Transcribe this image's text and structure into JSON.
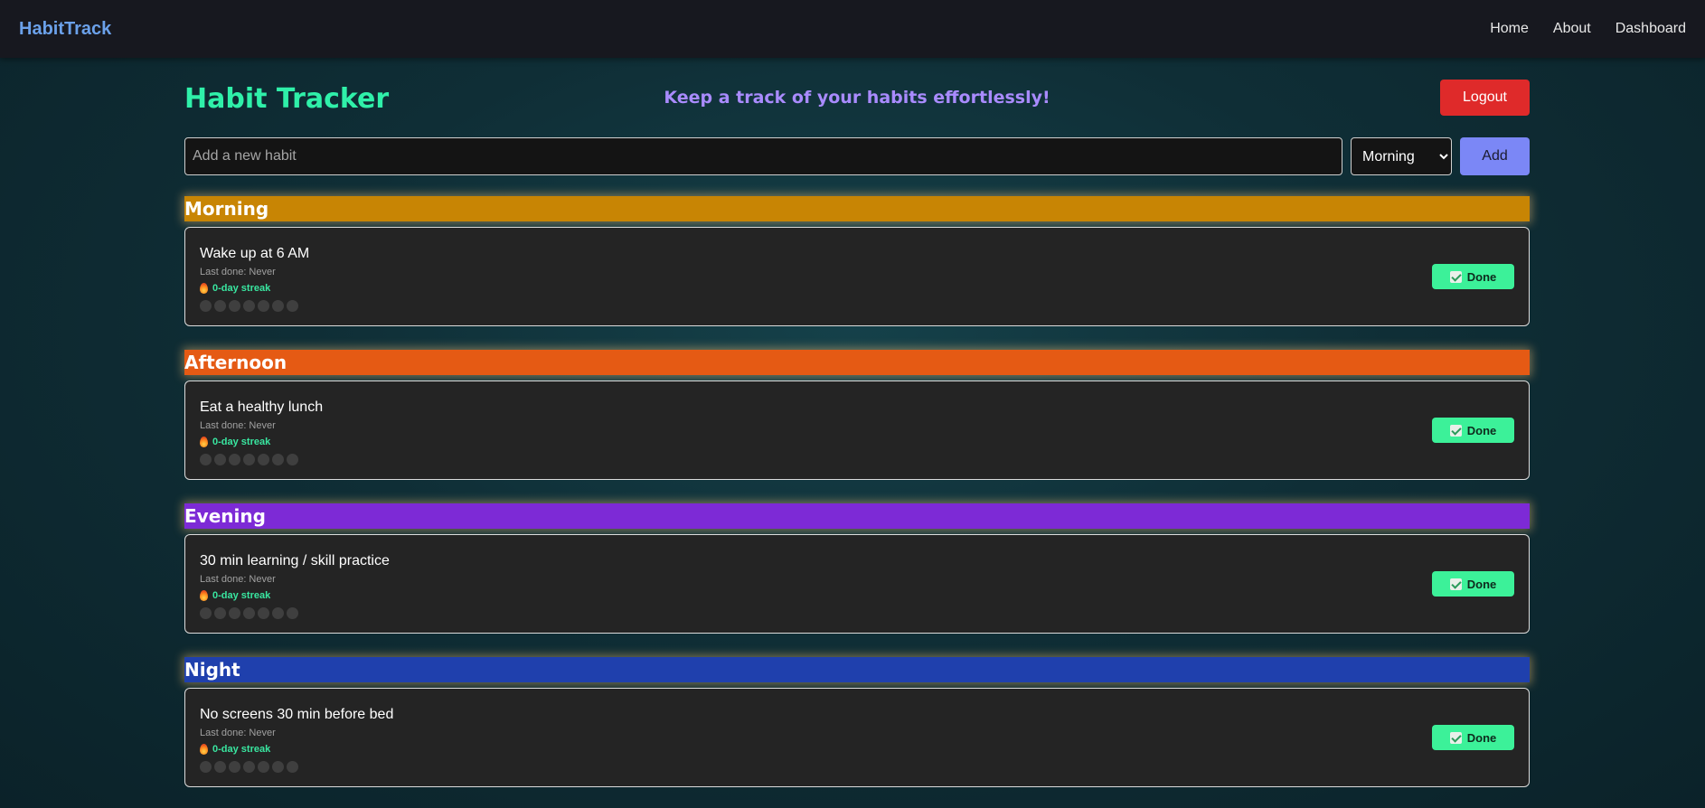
{
  "navbar": {
    "brand": "HabitTrack",
    "links": [
      "Home",
      "About",
      "Dashboard"
    ]
  },
  "header": {
    "title": "Habit Tracker",
    "tagline": "Keep a track of your habits effortlessly!",
    "logout_label": "Logout"
  },
  "add_form": {
    "placeholder": "Add a new habit",
    "period_selected": "Morning",
    "add_label": "Add"
  },
  "colors": {
    "morning": "#c88504",
    "afternoon": "#e55a14",
    "evening": "#7d2ad6",
    "night": "#1f40ad"
  },
  "sections": [
    {
      "name": "Morning",
      "habit": {
        "name": "Wake up at 6 AM",
        "last_done": "Last done: Never",
        "streak": "0-day streak",
        "done_label": "Done"
      }
    },
    {
      "name": "Afternoon",
      "habit": {
        "name": "Eat a healthy lunch",
        "last_done": "Last done: Never",
        "streak": "0-day streak",
        "done_label": "Done"
      }
    },
    {
      "name": "Evening",
      "habit": {
        "name": "30 min learning / skill practice",
        "last_done": "Last done: Never",
        "streak": "0-day streak",
        "done_label": "Done"
      }
    },
    {
      "name": "Night",
      "habit": {
        "name": "No screens 30 min before bed",
        "last_done": "Last done: Never",
        "streak": "0-day streak",
        "done_label": "Done"
      }
    }
  ],
  "icons": {
    "streak": "flame-icon",
    "done": "checkmark-icon",
    "history_dots": 7
  }
}
